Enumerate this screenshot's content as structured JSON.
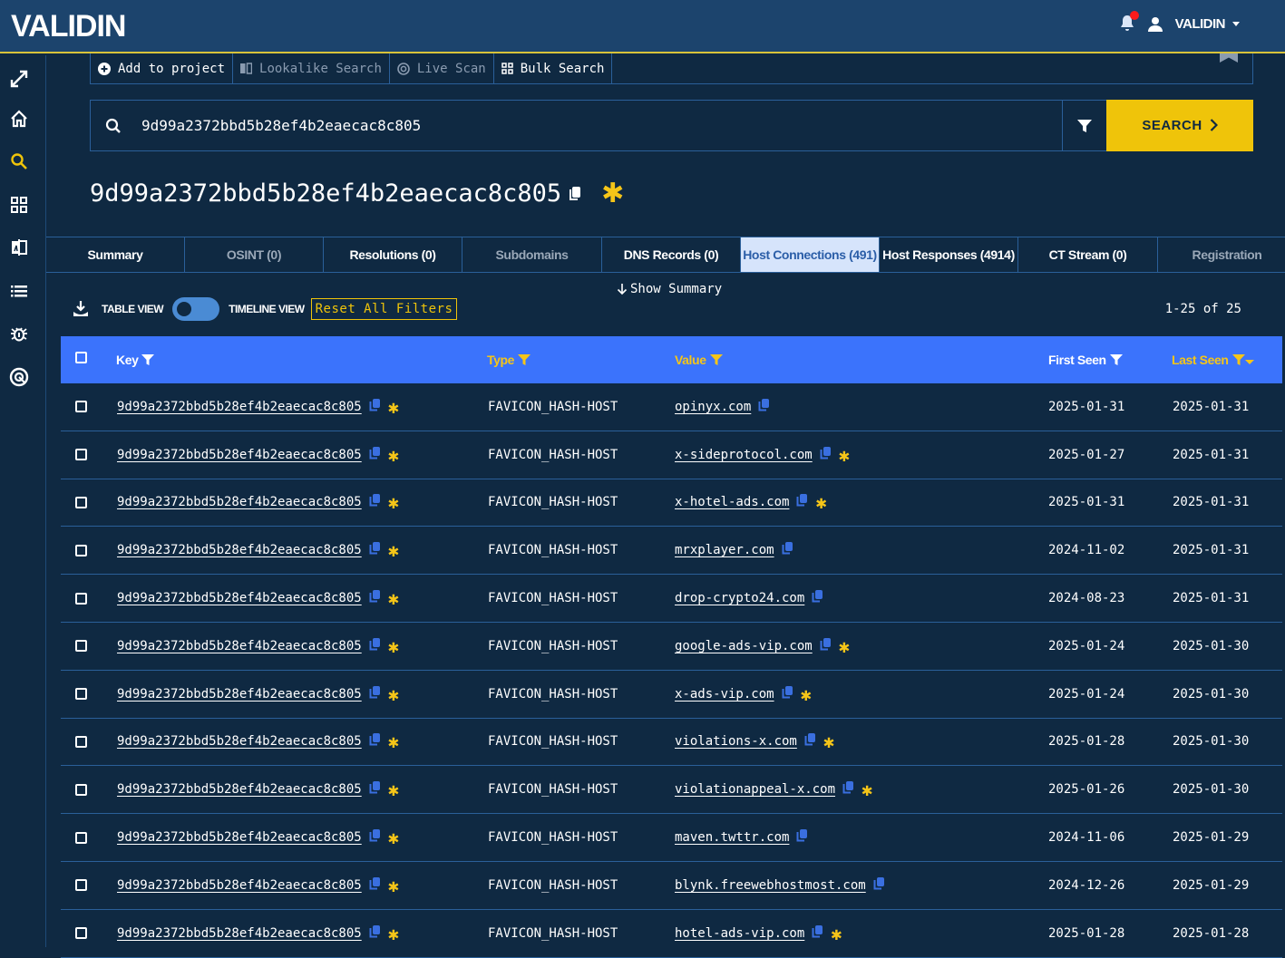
{
  "app": {
    "logo": "VALIDIN",
    "user": "VALIDIN"
  },
  "sidebar": {
    "items": [
      {
        "name": "expand",
        "icon": "expand-icon"
      },
      {
        "name": "home",
        "icon": "home-icon"
      },
      {
        "name": "search",
        "icon": "search-icon",
        "active": true
      },
      {
        "name": "dashboard",
        "icon": "grid-icon"
      },
      {
        "name": "lookalike",
        "icon": "lookalike-icon"
      },
      {
        "name": "list",
        "icon": "list-icon"
      },
      {
        "name": "malware",
        "icon": "bug-icon"
      },
      {
        "name": "scan",
        "icon": "target-icon"
      }
    ]
  },
  "toolbar": {
    "add_to_project": "Add to project",
    "lookalike_search": "Lookalike Search",
    "live_scan": "Live Scan",
    "bulk_search": "Bulk Search"
  },
  "search": {
    "value": "9d99a2372bbd5b28ef4b2eaecac8c805",
    "button": "SEARCH"
  },
  "page": {
    "title": "9d99a2372bbd5b28ef4b2eaecac8c805"
  },
  "tabs": [
    {
      "label": "Summary",
      "state": "normal"
    },
    {
      "label": "OSINT (0)",
      "state": "dim"
    },
    {
      "label": "Resolutions (0)",
      "state": "normal"
    },
    {
      "label": "Subdomains",
      "state": "dim"
    },
    {
      "label": "DNS Records (0)",
      "state": "normal"
    },
    {
      "label": "Host Connections (491)",
      "state": "active"
    },
    {
      "label": "Host Responses (4914)",
      "state": "normal"
    },
    {
      "label": "CT Stream (0)",
      "state": "normal"
    },
    {
      "label": "Registration",
      "state": "dim"
    }
  ],
  "controls": {
    "show_summary": "Show Summary",
    "table_view": "TABLE VIEW",
    "timeline_view": "TIMELINE VIEW",
    "reset_filters": "Reset All Filters",
    "pagination": "1-25 of 25"
  },
  "table": {
    "headers": {
      "key": "Key",
      "type": "Type",
      "value": "Value",
      "first_seen": "First Seen",
      "last_seen": "Last Seen"
    },
    "rows": [
      {
        "key": "9d99a2372bbd5b28ef4b2eaecac8c805",
        "type": "FAVICON_HASH-HOST",
        "value": "opinyx.com",
        "value_star": false,
        "first_seen": "2025-01-31",
        "last_seen": "2025-01-31"
      },
      {
        "key": "9d99a2372bbd5b28ef4b2eaecac8c805",
        "type": "FAVICON_HASH-HOST",
        "value": "x-sideprotocol.com",
        "value_star": true,
        "first_seen": "2025-01-27",
        "last_seen": "2025-01-31"
      },
      {
        "key": "9d99a2372bbd5b28ef4b2eaecac8c805",
        "type": "FAVICON_HASH-HOST",
        "value": "x-hotel-ads.com",
        "value_star": true,
        "first_seen": "2025-01-31",
        "last_seen": "2025-01-31"
      },
      {
        "key": "9d99a2372bbd5b28ef4b2eaecac8c805",
        "type": "FAVICON_HASH-HOST",
        "value": "mrxplayer.com",
        "value_star": false,
        "first_seen": "2024-11-02",
        "last_seen": "2025-01-31"
      },
      {
        "key": "9d99a2372bbd5b28ef4b2eaecac8c805",
        "type": "FAVICON_HASH-HOST",
        "value": "drop-crypto24.com",
        "value_star": false,
        "first_seen": "2024-08-23",
        "last_seen": "2025-01-31"
      },
      {
        "key": "9d99a2372bbd5b28ef4b2eaecac8c805",
        "type": "FAVICON_HASH-HOST",
        "value": "google-ads-vip.com",
        "value_star": true,
        "first_seen": "2025-01-24",
        "last_seen": "2025-01-30"
      },
      {
        "key": "9d99a2372bbd5b28ef4b2eaecac8c805",
        "type": "FAVICON_HASH-HOST",
        "value": "x-ads-vip.com",
        "value_star": true,
        "first_seen": "2025-01-24",
        "last_seen": "2025-01-30"
      },
      {
        "key": "9d99a2372bbd5b28ef4b2eaecac8c805",
        "type": "FAVICON_HASH-HOST",
        "value": "violations-x.com",
        "value_star": true,
        "first_seen": "2025-01-28",
        "last_seen": "2025-01-30"
      },
      {
        "key": "9d99a2372bbd5b28ef4b2eaecac8c805",
        "type": "FAVICON_HASH-HOST",
        "value": "violationappeal-x.com",
        "value_star": true,
        "first_seen": "2025-01-26",
        "last_seen": "2025-01-30"
      },
      {
        "key": "9d99a2372bbd5b28ef4b2eaecac8c805",
        "type": "FAVICON_HASH-HOST",
        "value": "maven.twttr.com",
        "value_star": false,
        "first_seen": "2024-11-06",
        "last_seen": "2025-01-29"
      },
      {
        "key": "9d99a2372bbd5b28ef4b2eaecac8c805",
        "type": "FAVICON_HASH-HOST",
        "value": "blynk.freewebhostmost.com",
        "value_star": false,
        "first_seen": "2024-12-26",
        "last_seen": "2025-01-29"
      },
      {
        "key": "9d99a2372bbd5b28ef4b2eaecac8c805",
        "type": "FAVICON_HASH-HOST",
        "value": "hotel-ads-vip.com",
        "value_star": true,
        "first_seen": "2025-01-28",
        "last_seen": "2025-01-28"
      }
    ]
  },
  "colors": {
    "background": "#0f2942",
    "topbar": "#1c446d",
    "accent_yellow": "#efc40a",
    "table_header": "#3b73fc",
    "active_tab_bg": "#d6e4fb",
    "copy_icon": "#3a6fe0"
  }
}
